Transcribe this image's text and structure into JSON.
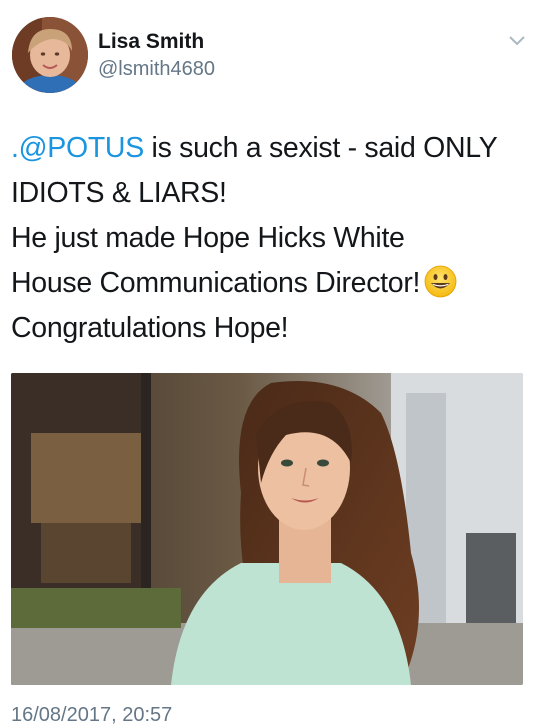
{
  "author": {
    "name": "Lisa Smith",
    "handle": "@lsmith4680"
  },
  "tweet": {
    "line1_mention": ".@POTUS",
    "line1_rest": " is such a sexist - said ONLY",
    "line2": "IDIOTS & LIARS!",
    "line3": "He just made Hope Hicks White",
    "line4": "House Communications Director!",
    "line5": "Congratulations Hope!"
  },
  "icons": {
    "emoji": "grinning-face",
    "menu": "chevron-down-icon"
  },
  "timestamp": "16/08/2017, 20:57",
  "colors": {
    "link": "#1b95e0",
    "text": "#14171a",
    "secondary": "#657786"
  }
}
